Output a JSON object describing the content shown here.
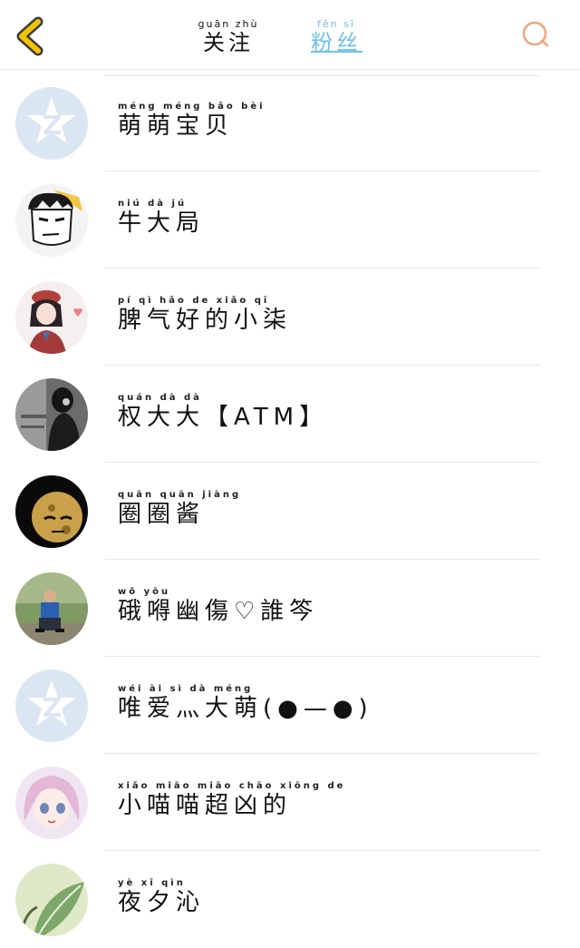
{
  "header": {
    "tabs": [
      {
        "label_py": "guān zhù",
        "label": "关注",
        "active": false
      },
      {
        "label_py": "fěn sī",
        "label": "粉丝",
        "active": true
      }
    ]
  },
  "icons": {
    "back": "chevron-left-icon",
    "search": "search-icon"
  },
  "colors": {
    "accent": "#6ec1e6",
    "back_yellow": "#f2c400",
    "search_orange": "#f2a37a"
  },
  "fans": [
    {
      "pinyin": "méng méng bǎo bèi",
      "name": "萌萌宝贝",
      "avatar": "default-qzone-avatar"
    },
    {
      "pinyin": "niú dà jú",
      "name": "牛大局",
      "avatar": "cartoon-man-avatar"
    },
    {
      "pinyin": "pí qì hǎo de xiǎo qī",
      "name": "脾气好的小柒",
      "avatar": "anime-girl-avatar"
    },
    {
      "pinyin": "quán dà dà",
      "name": "权大大【ATM】",
      "avatar": "dark-photo-avatar"
    },
    {
      "pinyin": "quān quān jiàng",
      "name": "圈圈酱",
      "avatar": "meme-face-avatar"
    },
    {
      "pinyin": "wǒ yōu",
      "name": "硪嘚幽傷♡誰笒",
      "avatar": "photo-man-avatar"
    },
    {
      "pinyin": "wéi ài sì dà méng",
      "name": "唯爱灬大萌(●—●)",
      "avatar": "default-qzone-avatar"
    },
    {
      "pinyin": "xiǎo miāo miāo chāo xiōng de",
      "name": "小喵喵超凶的",
      "avatar": "anime-pink-avatar"
    },
    {
      "pinyin": "yè xī qìn",
      "name": "夜夕沁",
      "avatar": "green-leaf-avatar"
    }
  ]
}
